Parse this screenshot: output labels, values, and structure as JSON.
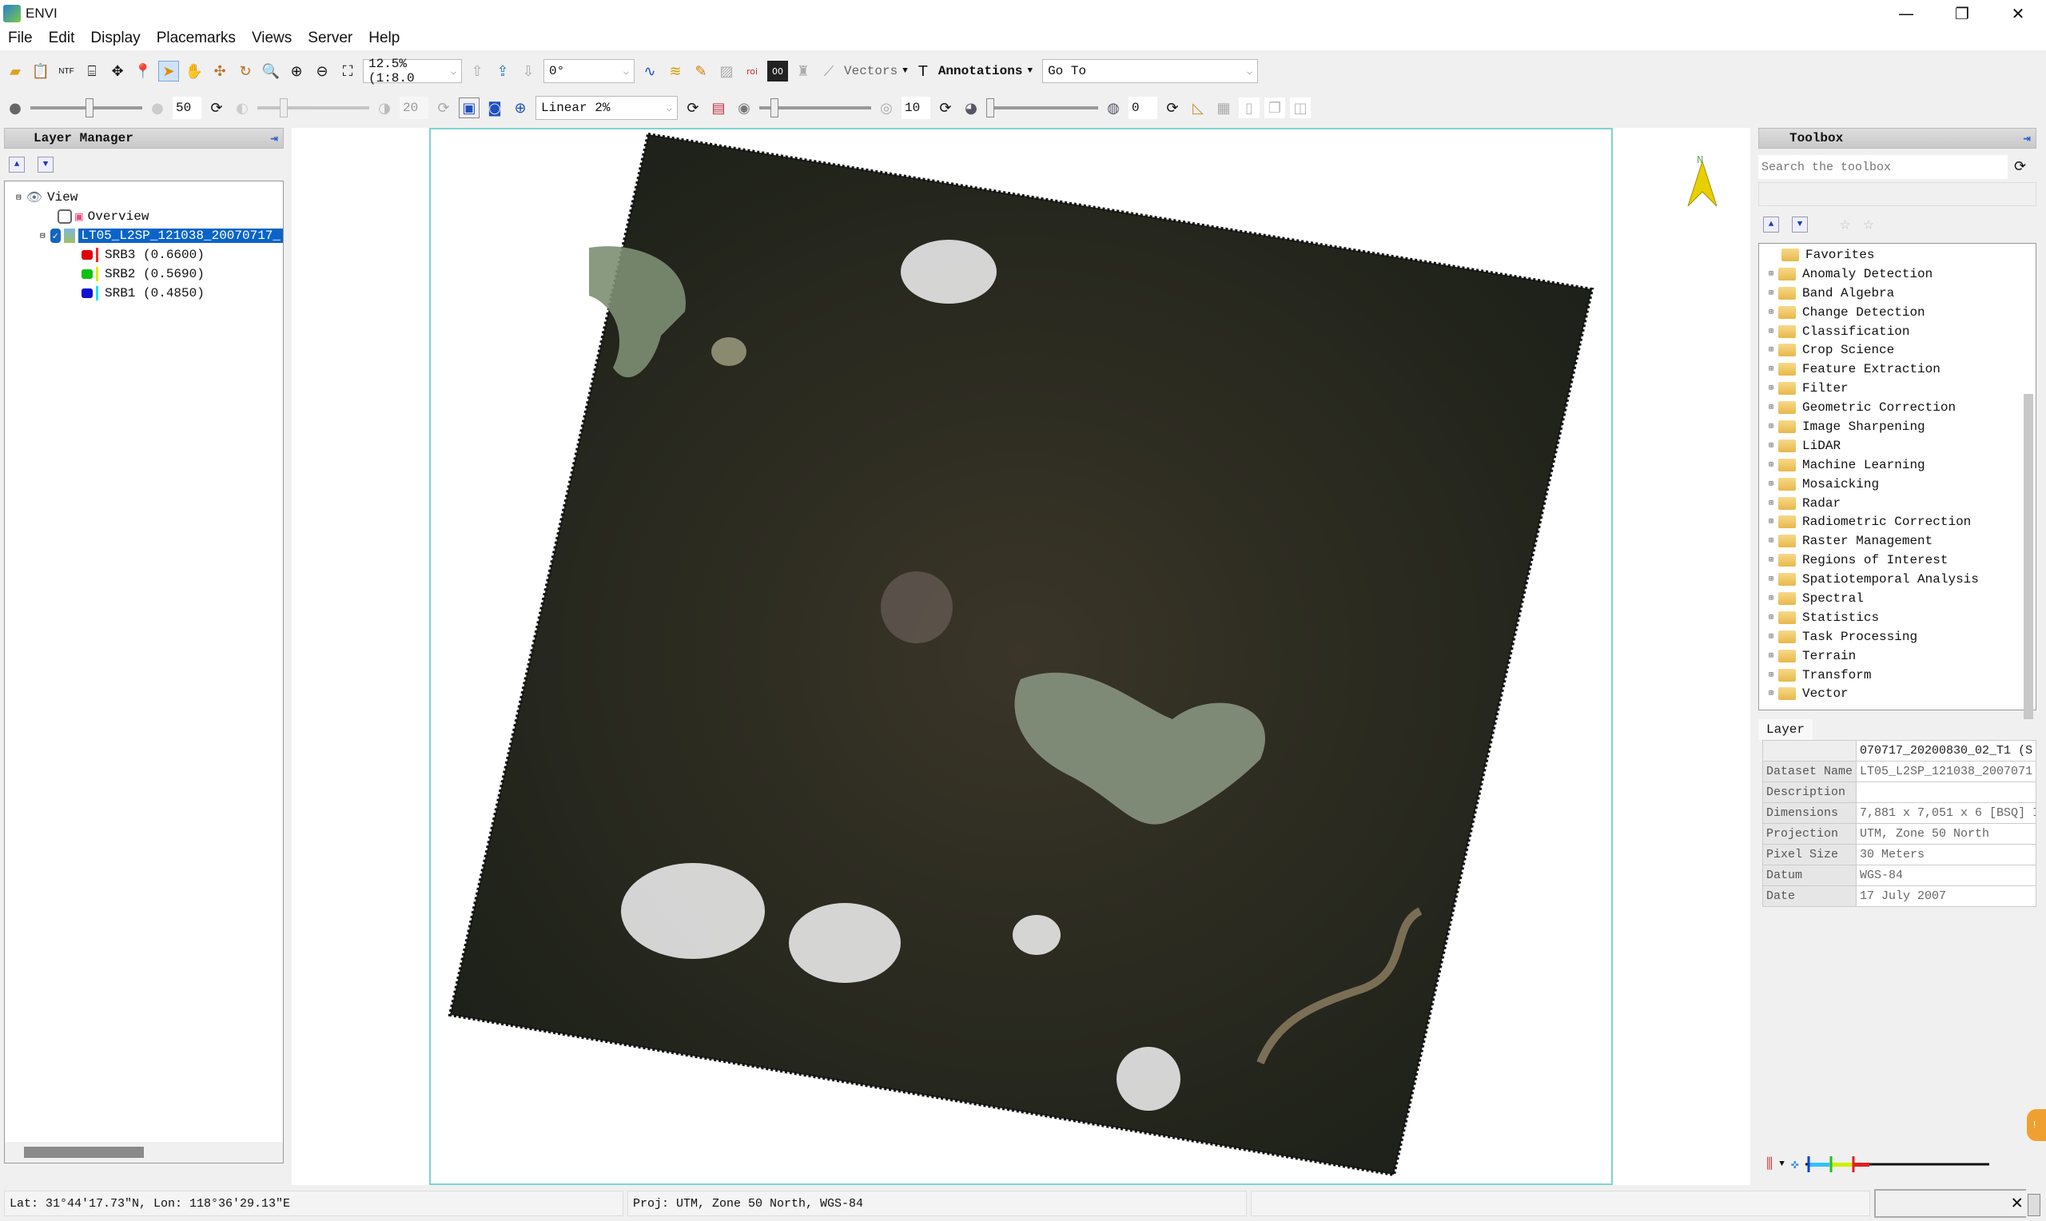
{
  "app": {
    "title": "ENVI"
  },
  "window_controls": {
    "minimize": "—",
    "restore": "❐",
    "close": "✕"
  },
  "menu": [
    "File",
    "Edit",
    "Display",
    "Placemarks",
    "Views",
    "Server",
    "Help"
  ],
  "toolbar": {
    "zoom_value": "12.5% (1:8.0",
    "rotation_value": "0°",
    "vectors_label": "Vectors",
    "annotations_label": "Annotations",
    "goto_value": "Go To",
    "ntf_label": "NTF",
    "roi_label": "roi"
  },
  "toolbar2": {
    "brightness": 50,
    "contrast": 20,
    "stretch": "Linear 2%",
    "sharpen": 10,
    "transparency": 0
  },
  "layer_manager": {
    "title": "Layer Manager",
    "view": "View",
    "overview": "Overview",
    "layer": "LT05_L2SP_121038_20070717_",
    "bands": [
      {
        "label": "SRB3 (0.6600)",
        "color": "#e00000",
        "bar": "#ff2020"
      },
      {
        "label": "SRB2 (0.5690)",
        "color": "#10c010",
        "bar": "#d8f000"
      },
      {
        "label": "SRB1 (0.4850)",
        "color": "#1010d0",
        "bar": "#20e0ff"
      }
    ]
  },
  "toolbox": {
    "title": "Toolbox",
    "search_placeholder": "Search the toolbox",
    "items": [
      "Favorites",
      "Anomaly Detection",
      "Band Algebra",
      "Change Detection",
      "Classification",
      "Crop Science",
      "Feature Extraction",
      "Filter",
      "Geometric Correction",
      "Image Sharpening",
      "LiDAR",
      "Machine Learning",
      "Mosaicking",
      "Radar",
      "Radiometric Correction",
      "Raster Management",
      "Regions of Interest",
      "Spatiotemporal Analysis",
      "Spectral",
      "Statistics",
      "Task Processing",
      "Terrain",
      "Transform",
      "Vector"
    ]
  },
  "layer_props": {
    "tab": "Layer",
    "header": "070717_20200830_02_T1 (S",
    "rows": [
      {
        "k": "Dataset Name",
        "v": "LT05_L2SP_121038_2007071"
      },
      {
        "k": "Description",
        "v": ""
      },
      {
        "k": "Dimensions",
        "v": "7,881 x 7,051 x 6 [BSQ] I"
      },
      {
        "k": "Projection",
        "v": "UTM, Zone 50 North"
      },
      {
        "k": "Pixel Size",
        "v": "30 Meters"
      },
      {
        "k": "Datum",
        "v": "WGS-84"
      },
      {
        "k": "Date",
        "v": "17 July 2007"
      }
    ]
  },
  "status": {
    "latlon": "Lat: 31°44'17.73\"N, Lon: 118°36'29.13\"E",
    "proj": "Proj: UTM, Zone 50 North, WGS-84"
  },
  "colors": {
    "selection": "#0a64c8",
    "view_border": "#7fd3d3",
    "north_arrow": "#e8d000"
  }
}
